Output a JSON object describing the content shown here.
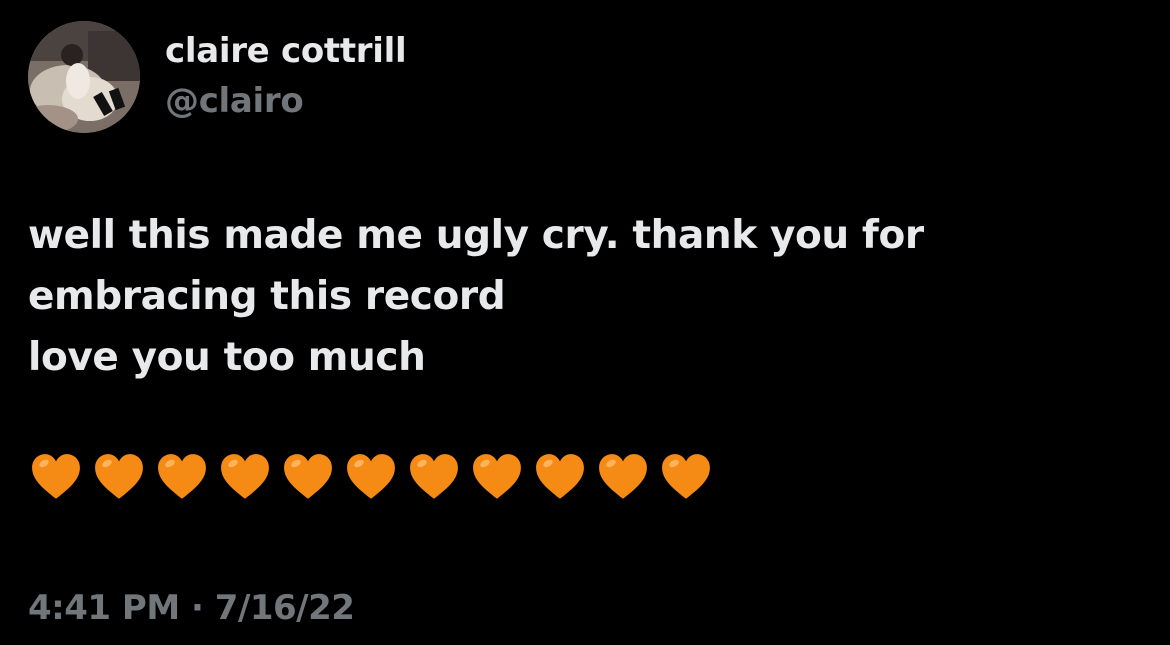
{
  "author": {
    "display_name": "claire cottrill",
    "handle": "@clairo"
  },
  "tweet": {
    "lines": [
      "well this made me ugly cry. thank you for",
      "embracing this record",
      "love you too much"
    ],
    "emoji": {
      "name": "orange-heart",
      "count": 11,
      "color": "#f58a14"
    }
  },
  "meta": {
    "time": "4:41 PM",
    "separator": "·",
    "date": "7/16/22"
  },
  "colors": {
    "background": "#000000",
    "primary_text": "#e7e9ea",
    "secondary_text": "#71767b"
  }
}
